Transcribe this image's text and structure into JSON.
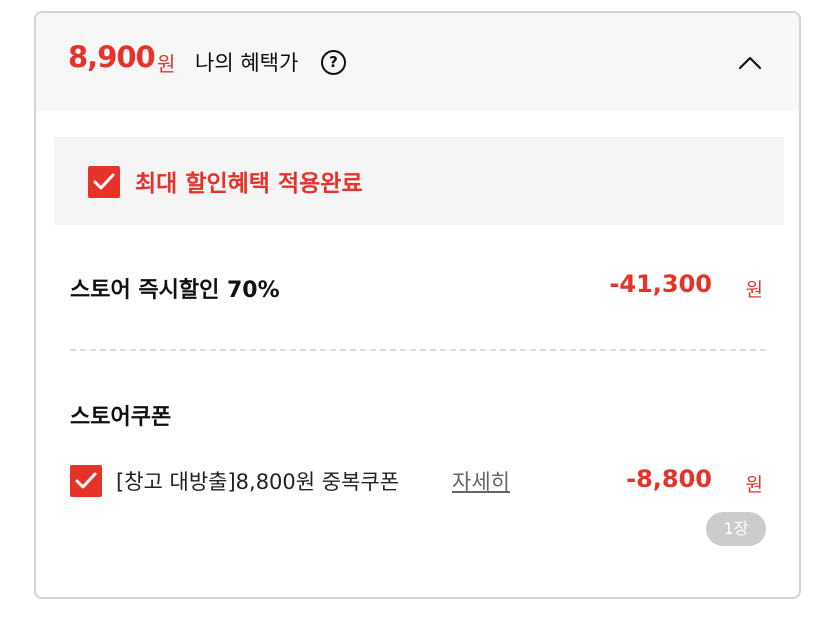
{
  "header": {
    "price": "8,900",
    "price_unit": "원",
    "benefit_label": "나의 혜택가",
    "help_glyph": "?",
    "toggle_icon": "chevron-up-icon"
  },
  "applied": {
    "checked": true,
    "label": "최대 할인혜택 적용완료"
  },
  "instant_discount": {
    "label": "스토어 즉시할인 70%",
    "amount": "-41,300",
    "unit": "원"
  },
  "store_coupon": {
    "title": "스토어쿠폰",
    "coupon": {
      "checked": true,
      "name": "[창고 대방출]8,800원 중복쿠폰",
      "detail_link": "자세히",
      "amount": "-8,800",
      "unit": "원",
      "count_badge": "1장"
    }
  },
  "colors": {
    "accent": "#e5332a",
    "badge": "#cccccc",
    "panel_bg": "#f7f7f7"
  }
}
